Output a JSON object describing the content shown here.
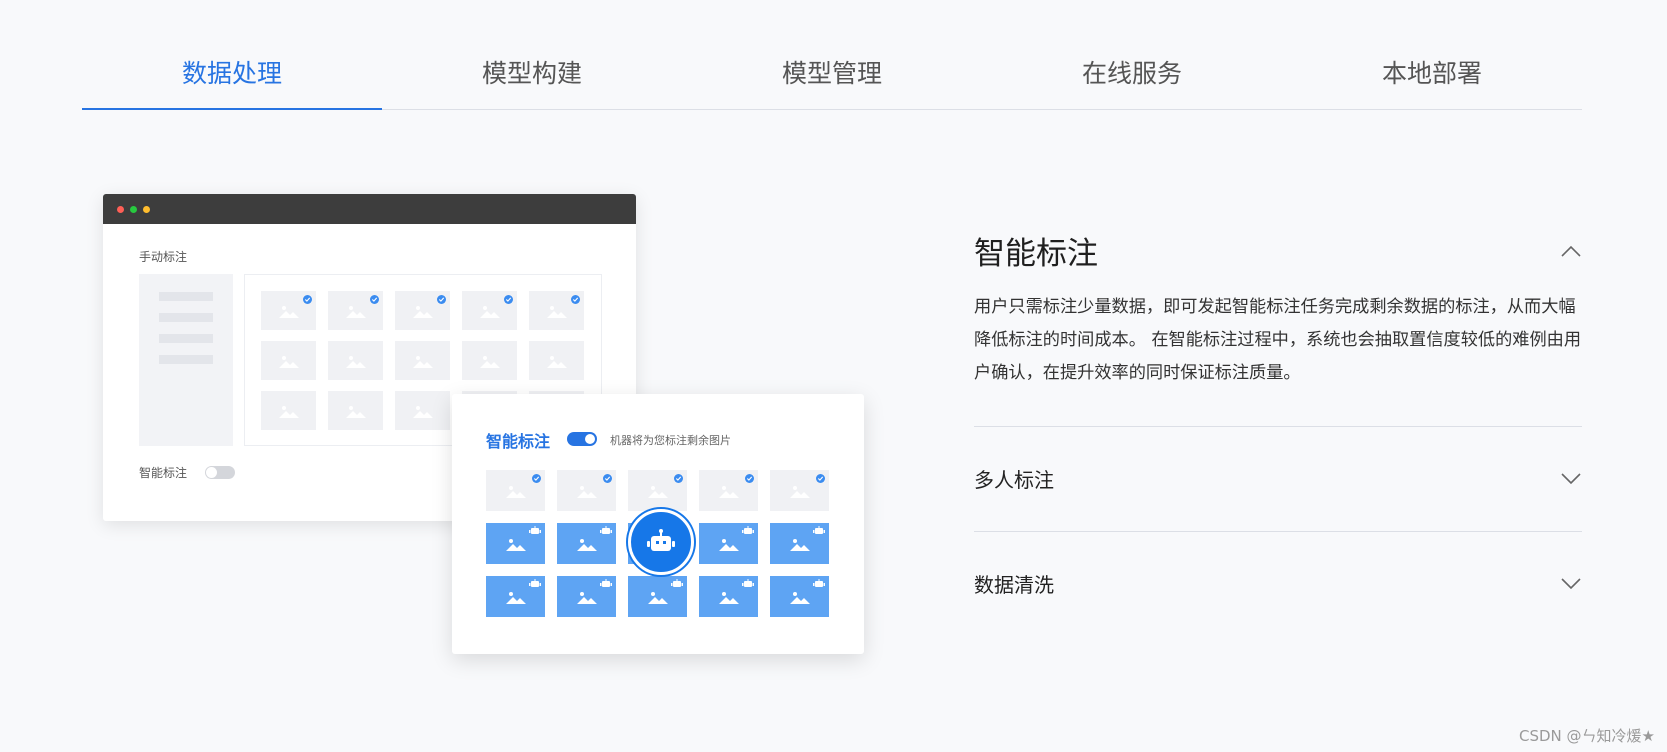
{
  "tabs": [
    {
      "label": "数据处理",
      "active": true
    },
    {
      "label": "模型构建",
      "active": false
    },
    {
      "label": "模型管理",
      "active": false
    },
    {
      "label": "在线服务",
      "active": false
    },
    {
      "label": "本地部署",
      "active": false
    }
  ],
  "illustration": {
    "manual_window": {
      "title": "手动标注",
      "toggle_label": "智能标注",
      "toggle_on": false
    },
    "smart_window": {
      "title": "智能标注",
      "toggle_on": true,
      "hint": "机器将为您标注剩余图片"
    }
  },
  "accordion": [
    {
      "title": "智能标注",
      "expanded": true,
      "description": "用户只需标注少量数据，即可发起智能标注任务完成剩余数据的标注，从而大幅降低标注的时间成本。 在智能标注过程中，系统也会抽取置信度较低的难例由用户确认，在提升效率的同时保证标注质量。"
    },
    {
      "title": "多人标注",
      "expanded": false
    },
    {
      "title": "数据清洗",
      "expanded": false
    }
  ],
  "watermark": "CSDN @ㄣ知冷煖★",
  "colors": {
    "accent": "#2774e2",
    "tile_blue": "#5ea4f3",
    "window_bar": "#3d3d3d",
    "background": "#f8f9fb"
  },
  "icons": {
    "collapse": "chevron-up-icon",
    "expand": "chevron-down-icon",
    "robot": "robot-icon",
    "image": "image-icon",
    "check": "check-icon"
  }
}
